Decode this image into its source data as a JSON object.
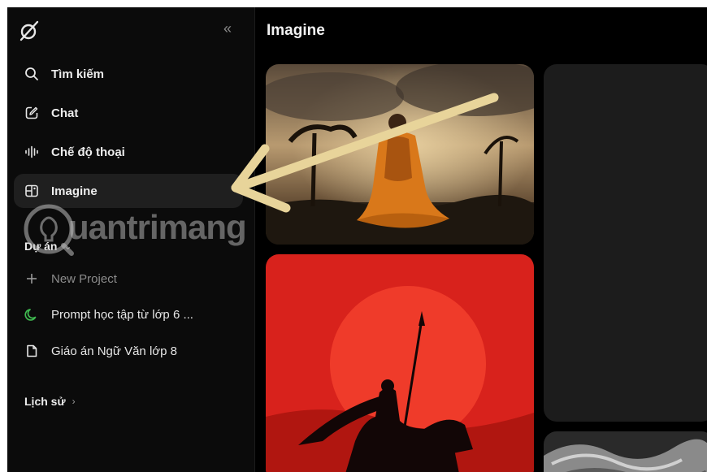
{
  "sidebar": {
    "nav": [
      {
        "label": "Tìm kiếm",
        "icon": "search-icon"
      },
      {
        "label": "Chat",
        "icon": "edit-icon"
      },
      {
        "label": "Chế độ thoại",
        "icon": "voice-wave-icon"
      },
      {
        "label": "Imagine",
        "icon": "image-gallery-icon"
      }
    ],
    "projects_heading": "Dự án",
    "projects": [
      {
        "label": "New Project",
        "icon": "plus-icon"
      },
      {
        "label": "Prompt học tập từ lớp 6 ...",
        "icon": "moon-icon"
      },
      {
        "label": "Giáo án Ngữ Văn lớp 8",
        "icon": "document-icon"
      }
    ],
    "history_heading": "Lịch sử"
  },
  "main": {
    "title": "Imagine"
  },
  "watermark": {
    "text": "uantrimang"
  },
  "colors": {
    "background": "#000000",
    "sidebar": "#0b0b0b",
    "active_item": "#1f1f1f",
    "arrow": "#e8d49a",
    "accent_green": "#3fb950",
    "poster_red": "#d8221c"
  }
}
